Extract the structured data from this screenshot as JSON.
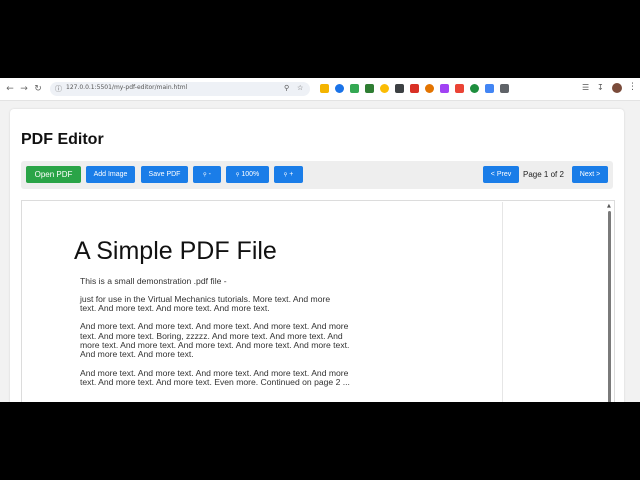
{
  "browser": {
    "url": "127.0.0.1:5501/my-pdf-editor/main.html",
    "icons": {
      "back": "arrow-left-icon",
      "forward": "arrow-right-icon",
      "reload": "reload-icon",
      "info": "site-info-icon",
      "zoom": "zoom-icon",
      "bookmark": "star-icon",
      "menu": "more-vert-icon"
    },
    "extension_colors": [
      "#f4b400",
      "#1a73e8",
      "#34a853",
      "#2e7d32",
      "#fbbc04",
      "#3c4043",
      "#d93025",
      "#e37400",
      "#a142f4",
      "#ea4335",
      "#1e8e3e",
      "#4285f4",
      "#5f6368"
    ]
  },
  "editor": {
    "title": "PDF Editor",
    "toolbar": {
      "open_label": "Open PDF",
      "add_image_label": "Add Image",
      "save_label": "Save PDF",
      "zoom_out_label": "-",
      "zoom_reset_label": "100%",
      "zoom_in_label": "+",
      "prev_label": "< Prev",
      "next_label": "Next >",
      "page_info": "Page 1 of 2"
    },
    "colors": {
      "primary": "#1a7de8",
      "success": "#2aa447"
    }
  },
  "pdf": {
    "heading": "A Simple PDF File",
    "lines": [
      "This is a small demonstration .pdf file -",
      "just for use in the Virtual Mechanics tutorials. More text. And more",
      "text. And more text. And more text. And more text.",
      "And more text. And more text. And more text. And more text. And more",
      "text. And more text. Boring, zzzzz. And more text. And more text. And",
      "more text. And more text. And more text. And more text. And more text.",
      "And more text. And more text.",
      "And more text. And more text. And more text. And more text. And more",
      "text. And more text. And more text. Even more. Continued on page 2 ..."
    ]
  }
}
